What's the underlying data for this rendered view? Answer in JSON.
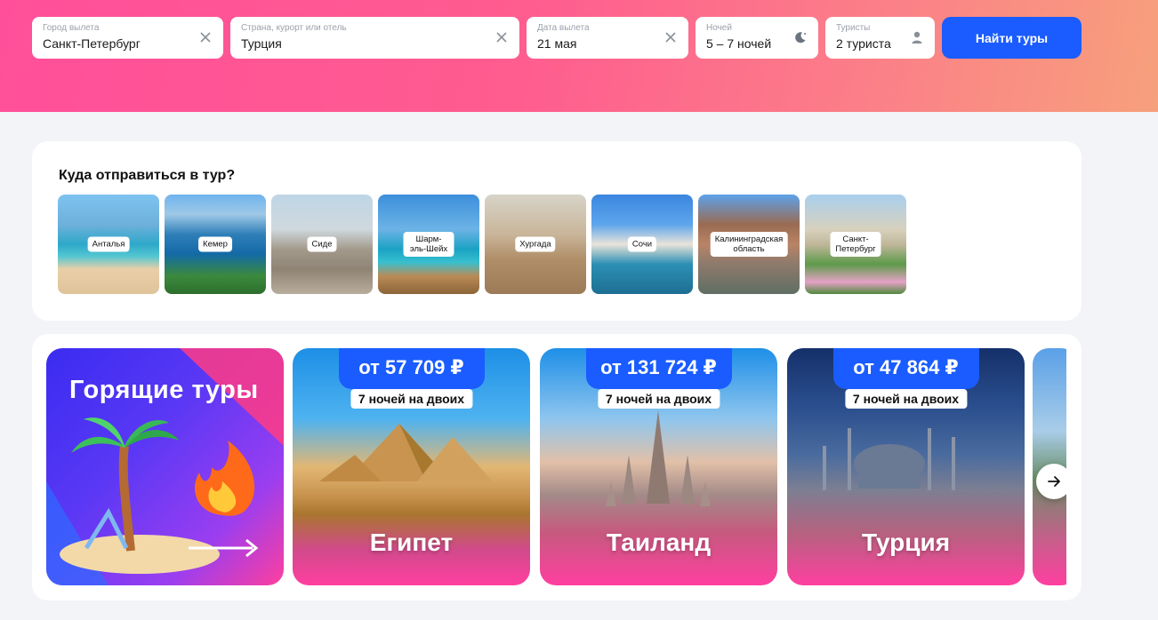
{
  "search": {
    "departure": {
      "label": "Город вылета",
      "value": "Санкт-Петербург"
    },
    "destination": {
      "label": "Страна, курорт или отель",
      "value": "Турция"
    },
    "date": {
      "label": "Дата вылета",
      "value": "21 мая"
    },
    "nights": {
      "label": "Ночей",
      "value": "5 – 7 ночей"
    },
    "tourists": {
      "label": "Туристы",
      "value": "2 туриста"
    },
    "button_label": "Найти туры"
  },
  "destinations": {
    "title": "Куда отправиться в тур?",
    "items": [
      {
        "label": "Анталья"
      },
      {
        "label": "Кемер"
      },
      {
        "label": "Сиде"
      },
      {
        "label": "Шарм-эль-Шейх"
      },
      {
        "label": "Хургада"
      },
      {
        "label": "Сочи"
      },
      {
        "label": "Калининградская область"
      },
      {
        "label": "Санкт-Петербург"
      }
    ]
  },
  "promo": {
    "hot_title": "Горящие туры",
    "offers": [
      {
        "price": "от 57 709 ₽",
        "nights": "7 ночей на двоих",
        "country": "Египет"
      },
      {
        "price": "от 131 724 ₽",
        "nights": "7 ночей на двоих",
        "country": "Таиланд"
      },
      {
        "price": "от 47 864 ₽",
        "nights": "7 ночей на двоих",
        "country": "Турция"
      }
    ]
  },
  "colors": {
    "accent": "#1a5cff",
    "hero_pink": "#ff4f9a",
    "hero_peach": "#f7a07c"
  }
}
